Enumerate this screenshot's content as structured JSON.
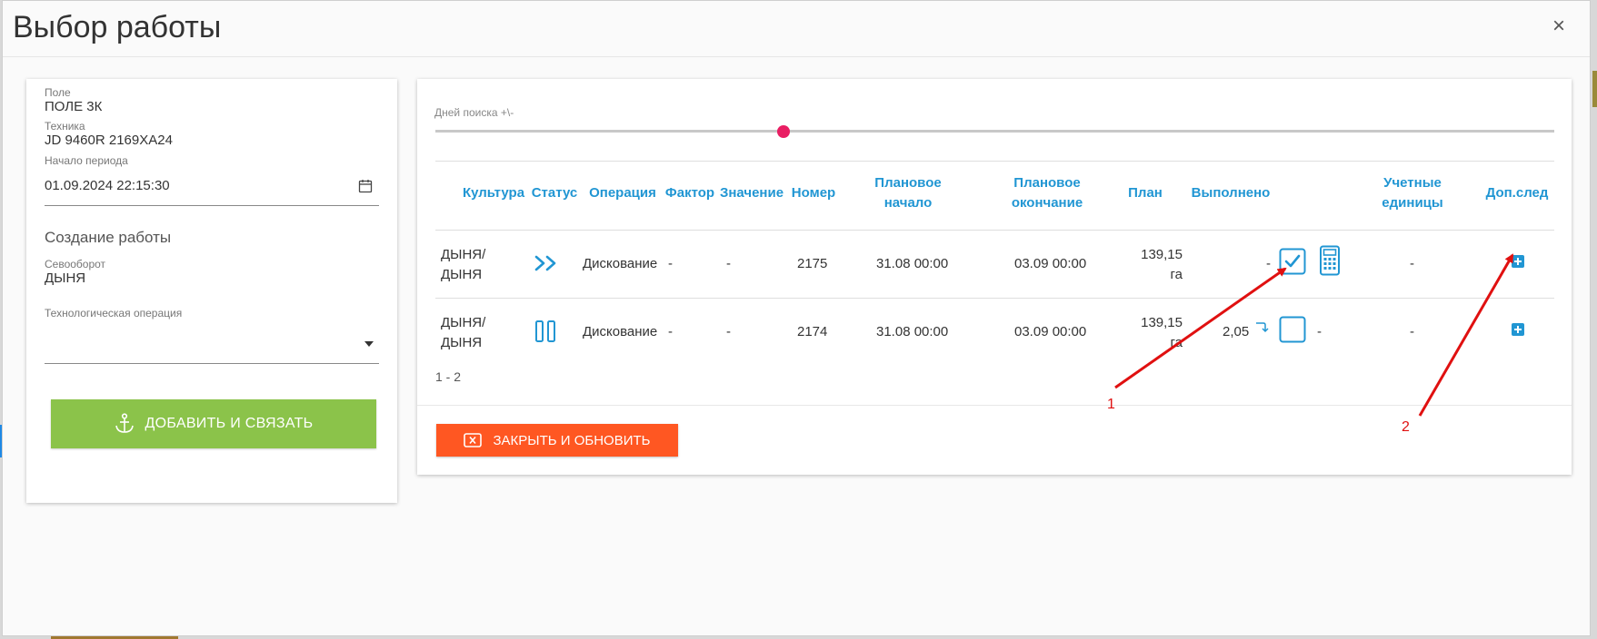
{
  "title": "Выбор работы",
  "left": {
    "field_label": "Поле",
    "field_value": "ПОЛЕ 3К",
    "machine_label": "Техника",
    "machine_value": "JD 9460R 2169ХА24",
    "period_label": "Начало периода",
    "period_value": "01.09.2024 22:15:30",
    "create_title": "Создание работы",
    "rotation_label": "Севооборот",
    "rotation_value": "ДЫНЯ",
    "operation_label": "Технологическая операция",
    "operation_value": "",
    "add_button": "ДОБАВИТЬ И СВЯЗАТЬ"
  },
  "right": {
    "slider_label": "Дней поиска +\\-",
    "slider_value_fraction": 0.303,
    "columns": {
      "culture": "Культура",
      "status": "Статус",
      "operation": "Операция",
      "factor": "Фактор",
      "value": "Значение",
      "number": "Номер",
      "plan_start_1": "Плановое",
      "plan_start_2": "начало",
      "plan_end_1": "Плановое",
      "plan_end_2": "окончание",
      "plan": "План",
      "done": "Выполнено",
      "units_1": "Учетные",
      "units_2": "единицы",
      "extra": "Доп.след"
    },
    "rows": [
      {
        "culture_1": "ДЫНЯ/",
        "culture_2": "ДЫНЯ",
        "status_icon": "play-chevrons-icon",
        "operation": "Дискование",
        "factor": "-",
        "value": "-",
        "number": "2175",
        "plan_start": "31.08 00:00",
        "plan_end": "03.09 00:00",
        "plan_1": "139,15",
        "plan_2": "га",
        "done": "-",
        "units": "-"
      },
      {
        "culture_1": "ДЫНЯ/",
        "culture_2": "ДЫНЯ",
        "status_icon": "pause-icon",
        "operation": "Дискование",
        "factor": "-",
        "value": "-",
        "number": "2174",
        "plan_start": "31.08 00:00",
        "plan_end": "03.09 00:00",
        "plan_1": "139,15",
        "plan_2": "га",
        "done": "2,05",
        "after_checkbox": "-",
        "units": "-"
      }
    ],
    "pager": "1 - 2",
    "close_button": "ЗАКРЫТЬ И ОБНОВИТЬ"
  },
  "annotations": {
    "arrow1_label": "1",
    "arrow2_label": "2",
    "color": "#e01010"
  },
  "colors": {
    "accent": "#2196d3",
    "add_button": "#8bc34a",
    "close_button": "#ff5722",
    "slider_thumb": "#e91e63"
  }
}
